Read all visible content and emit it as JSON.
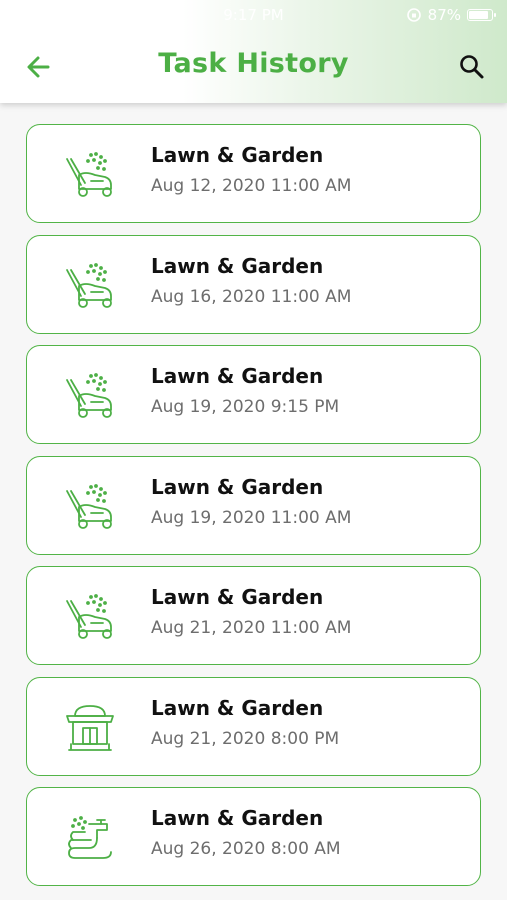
{
  "status_bar": {
    "time": "9:17 PM",
    "battery": "87%",
    "battery_level": 0.87
  },
  "header": {
    "title": "Task History",
    "back_icon": "arrow-left-icon",
    "search_icon": "search-icon"
  },
  "colors": {
    "accent": "#4caf45",
    "card_border": "#52b447",
    "date_text": "#6d6d6d"
  },
  "tasks": [
    {
      "title": "Lawn & Garden",
      "date": "Aug 12, 2020 11:00 AM",
      "icon": "lawn-mower-icon"
    },
    {
      "title": "Lawn & Garden",
      "date": "Aug 16, 2020 11:00 AM",
      "icon": "lawn-mower-icon"
    },
    {
      "title": "Lawn & Garden",
      "date": "Aug 19, 2020 9:15 PM",
      "icon": "lawn-mower-icon"
    },
    {
      "title": "Lawn & Garden",
      "date": "Aug 19, 2020 11:00 AM",
      "icon": "lawn-mower-icon"
    },
    {
      "title": "Lawn & Garden",
      "date": "Aug 21, 2020 11:00 AM",
      "icon": "lawn-mower-icon"
    },
    {
      "title": "Lawn & Garden",
      "date": "Aug 21, 2020 8:00 PM",
      "icon": "bbq-grill-icon"
    },
    {
      "title": "Lawn & Garden",
      "date": "Aug 26, 2020 8:00 AM",
      "icon": "garden-hose-icon"
    }
  ]
}
